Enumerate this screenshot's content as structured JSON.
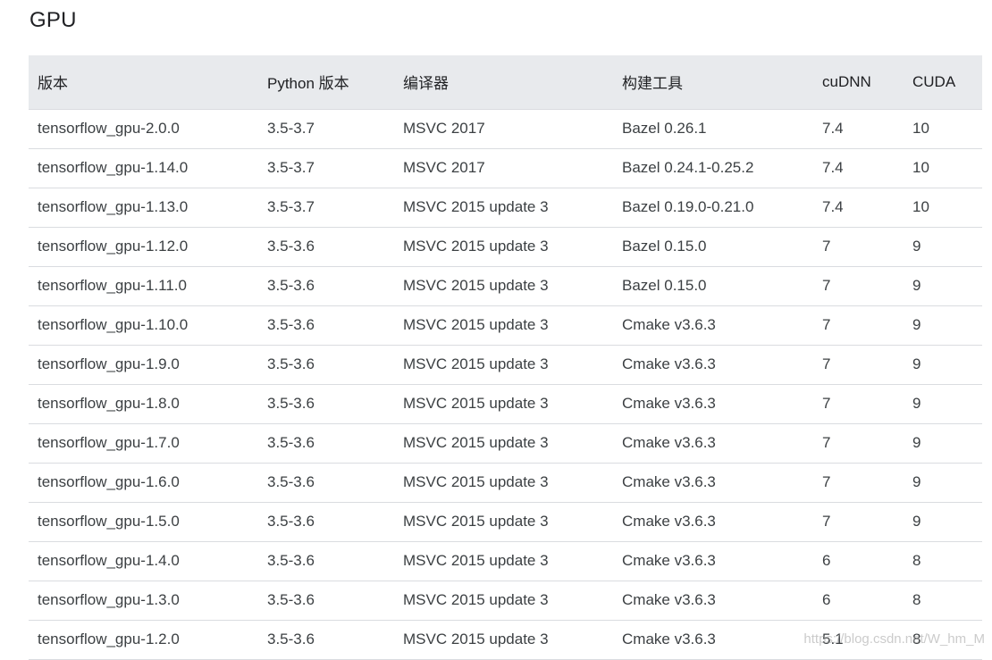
{
  "page_title": "GPU",
  "table": {
    "headers": [
      "版本",
      "Python 版本",
      "编译器",
      "构建工具",
      "cuDNN",
      "CUDA"
    ],
    "rows": [
      [
        "tensorflow_gpu-2.0.0",
        "3.5-3.7",
        "MSVC 2017",
        "Bazel 0.26.1",
        "7.4",
        "10"
      ],
      [
        "tensorflow_gpu-1.14.0",
        "3.5-3.7",
        "MSVC 2017",
        "Bazel 0.24.1-0.25.2",
        "7.4",
        "10"
      ],
      [
        "tensorflow_gpu-1.13.0",
        "3.5-3.7",
        "MSVC 2015 update 3",
        "Bazel 0.19.0-0.21.0",
        "7.4",
        "10"
      ],
      [
        "tensorflow_gpu-1.12.0",
        "3.5-3.6",
        "MSVC 2015 update 3",
        "Bazel 0.15.0",
        "7",
        "9"
      ],
      [
        "tensorflow_gpu-1.11.0",
        "3.5-3.6",
        "MSVC 2015 update 3",
        "Bazel 0.15.0",
        "7",
        "9"
      ],
      [
        "tensorflow_gpu-1.10.0",
        "3.5-3.6",
        "MSVC 2015 update 3",
        "Cmake v3.6.3",
        "7",
        "9"
      ],
      [
        "tensorflow_gpu-1.9.0",
        "3.5-3.6",
        "MSVC 2015 update 3",
        "Cmake v3.6.3",
        "7",
        "9"
      ],
      [
        "tensorflow_gpu-1.8.0",
        "3.5-3.6",
        "MSVC 2015 update 3",
        "Cmake v3.6.3",
        "7",
        "9"
      ],
      [
        "tensorflow_gpu-1.7.0",
        "3.5-3.6",
        "MSVC 2015 update 3",
        "Cmake v3.6.3",
        "7",
        "9"
      ],
      [
        "tensorflow_gpu-1.6.0",
        "3.5-3.6",
        "MSVC 2015 update 3",
        "Cmake v3.6.3",
        "7",
        "9"
      ],
      [
        "tensorflow_gpu-1.5.0",
        "3.5-3.6",
        "MSVC 2015 update 3",
        "Cmake v3.6.3",
        "7",
        "9"
      ],
      [
        "tensorflow_gpu-1.4.0",
        "3.5-3.6",
        "MSVC 2015 update 3",
        "Cmake v3.6.3",
        "6",
        "8"
      ],
      [
        "tensorflow_gpu-1.3.0",
        "3.5-3.6",
        "MSVC 2015 update 3",
        "Cmake v3.6.3",
        "6",
        "8"
      ],
      [
        "tensorflow_gpu-1.2.0",
        "3.5-3.6",
        "MSVC 2015 update 3",
        "Cmake v3.6.3",
        "5.1",
        "8"
      ]
    ]
  },
  "watermark": "https://blog.csdn.net/W_hm_M",
  "colors": {
    "header_background": "#e8eaed",
    "row_border": "#dadce0",
    "text": "#3c4043"
  }
}
